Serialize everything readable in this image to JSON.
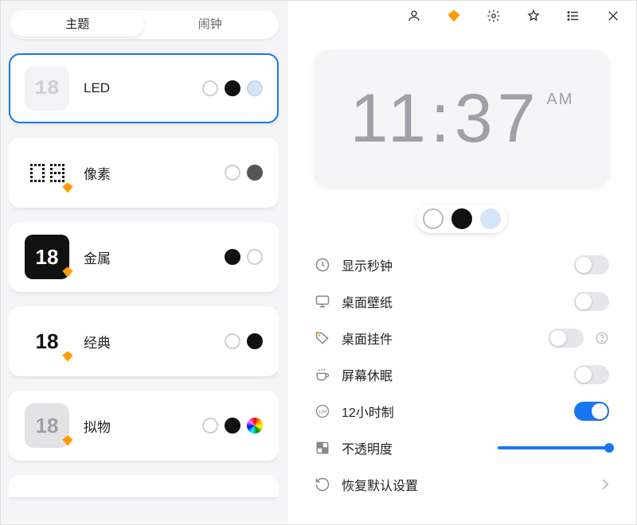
{
  "tabs": {
    "theme": "主题",
    "alarm": "闹钟"
  },
  "themes": [
    {
      "id": "led",
      "label": "LED",
      "thumb": "18"
    },
    {
      "id": "pixel",
      "label": "像素",
      "thumb": "08"
    },
    {
      "id": "metal",
      "label": "金属",
      "thumb": "18"
    },
    {
      "id": "classic",
      "label": "经典",
      "thumb": "18"
    },
    {
      "id": "skeuo",
      "label": "拟物",
      "thumb": "18"
    }
  ],
  "clock": {
    "time": "11:37",
    "ampm": "AM"
  },
  "settings": {
    "show_seconds": {
      "label": "显示秒钟",
      "on": false
    },
    "wallpaper": {
      "label": "桌面壁纸",
      "on": false
    },
    "desktop_widget": {
      "label": "桌面挂件",
      "on": false
    },
    "screen_sleep": {
      "label": "屏幕休眠",
      "on": false
    },
    "hour12": {
      "label": "12小时制",
      "on": true
    },
    "opacity": {
      "label": "不透明度"
    },
    "reset": {
      "label": "恢复默认设置"
    }
  }
}
